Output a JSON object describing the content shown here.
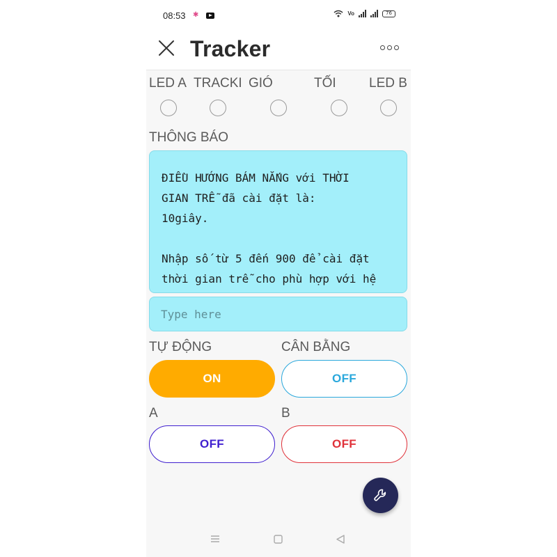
{
  "status": {
    "time": "08:53",
    "battery": "76"
  },
  "header": {
    "title": "Tracker",
    "close_icon": "close-icon",
    "more_icon": "more-icon"
  },
  "leds": [
    {
      "label": "LED A",
      "state": "off"
    },
    {
      "label": "TRACKI",
      "state": "off"
    },
    {
      "label": "GIÓ",
      "state": "off"
    },
    {
      "label": "TỐI",
      "state": "off"
    },
    {
      "label": "LED B",
      "state": "off"
    }
  ],
  "notice": {
    "label": "THÔNG BÁO",
    "text": "ĐIỀU HƯỚNG BÁM NẮNG với THỜI\nGIAN TRỄ đã cài đặt là:\n10giây.\n\nNhập số từ 5 đến 900 để cài đặt\nthời gian trễ cho phù hợp với hệ"
  },
  "input": {
    "placeholder": "Type here",
    "value": ""
  },
  "switches": {
    "auto": {
      "label": "TỰ ĐỘNG",
      "value": "ON",
      "color": "#ffab00"
    },
    "balance": {
      "label": "CÂN BẰNG",
      "value": "OFF",
      "color": "#2aa8dc"
    },
    "a": {
      "label": "A",
      "value": "OFF",
      "color": "#3f1fcf"
    },
    "b": {
      "label": "B",
      "value": "OFF",
      "color": "#e0323a"
    }
  },
  "fab": {
    "icon": "wrench-icon"
  },
  "colors": {
    "notice_bg": "#a3effa",
    "fab_bg": "#252858"
  }
}
